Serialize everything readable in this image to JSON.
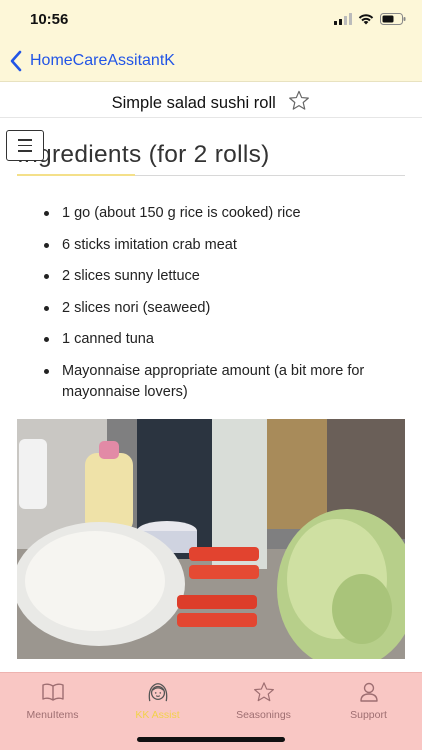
{
  "status_bar": {
    "time": "10:56",
    "signal_icon": "cellular-signal-icon",
    "wifi_icon": "wifi-icon",
    "battery_icon": "battery-icon"
  },
  "nav": {
    "back_label": "HomeCareAssitantK",
    "back_icon": "chevron-left-icon"
  },
  "recipe": {
    "title": "Simple salad sushi roll",
    "favorite_icon": "star-outline-icon"
  },
  "content": {
    "menu_icon": "hamburger-menu-icon",
    "heading": "Ingredients (for 2 rolls)",
    "ingredients": [
      "1 go (about 150 g rice is cooked) rice",
      "6 sticks imitation crab meat",
      "2 slices sunny lettuce",
      "2 slices nori (seaweed)",
      "1 canned tuna",
      "Mayonnaise appropriate amount (a bit more for mayonnaise lovers)"
    ],
    "photo_icon": "ingredients-photo"
  },
  "tabs": [
    {
      "label": "MenuItems",
      "icon": "book-icon",
      "active": false
    },
    {
      "label": "KK Assist",
      "icon": "girl-face-icon",
      "active": true
    },
    {
      "label": "Seasonings",
      "icon": "star-outline-icon",
      "active": false
    },
    {
      "label": "Support",
      "icon": "person-icon",
      "active": false
    }
  ],
  "colors": {
    "header_bg": "#fdf7d8",
    "link_blue": "#2255e6",
    "tab_bar_bg": "#f9c7c4",
    "tab_inactive": "#9e6e71",
    "tab_active": "#f2d24a"
  }
}
